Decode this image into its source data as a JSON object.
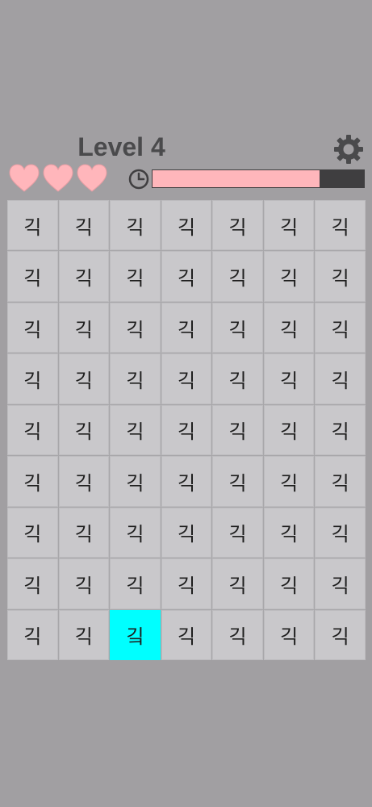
{
  "header": {
    "level_label": "Level 4",
    "settings_icon": "gear-icon"
  },
  "status": {
    "lives": 3,
    "heart_icon": "heart-icon",
    "heart_color": "#ffb6bb",
    "timer_icon": "clock-icon",
    "timer_remaining_fraction": 0.79,
    "timer_fill_color": "#ffb6bb",
    "timer_track_color": "#3f3e40"
  },
  "board": {
    "columns": 7,
    "rows": 9,
    "tile_char": "긱",
    "odd_char": "깈",
    "odd_row": 9,
    "odd_col": 3,
    "odd_color": "#00ffff"
  }
}
